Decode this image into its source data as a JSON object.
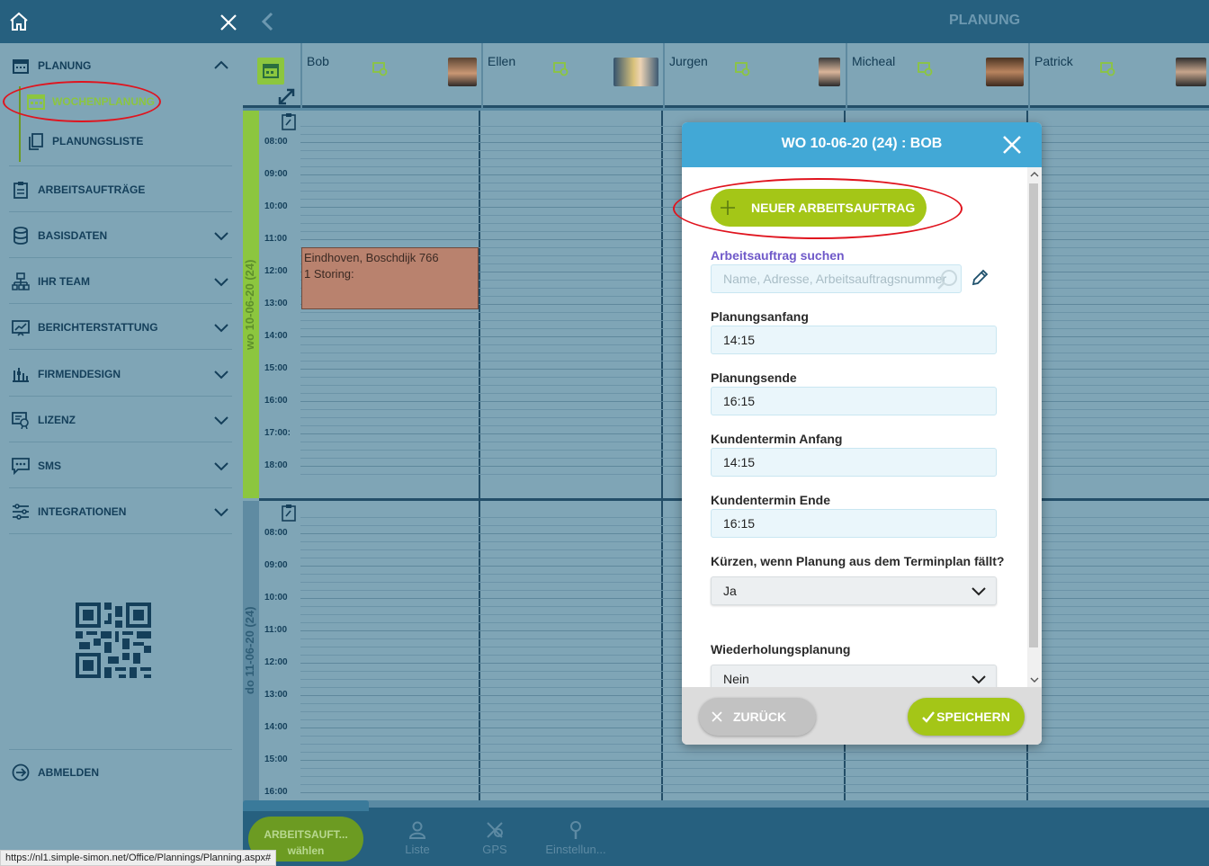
{
  "sidebar": {
    "home_icon": "home-icon",
    "close_icon": "close-icon",
    "planung": {
      "label": "PLANUNG",
      "icon": "calendar-icon"
    },
    "sub_items": [
      {
        "label": "WOCHENPLANUNG",
        "icon": "calendar-icon",
        "active": true
      },
      {
        "label": "PLANUNGSLISTE",
        "icon": "copy-icon",
        "active": false
      }
    ],
    "items": [
      {
        "label": "ARBEITSAUFTRÄGE",
        "icon": "clipboard-icon"
      },
      {
        "label": "BASISDATEN",
        "icon": "database-icon"
      },
      {
        "label": "IHR TEAM",
        "icon": "team-icon"
      },
      {
        "label": "BERICHTERSTATTUNG",
        "icon": "report-icon"
      },
      {
        "label": "FIRMENDESIGN",
        "icon": "design-icon"
      },
      {
        "label": "LIZENZ",
        "icon": "license-icon"
      },
      {
        "label": "SMS",
        "icon": "sms-icon"
      },
      {
        "label": "INTEGRATIONEN",
        "icon": "sliders-icon"
      }
    ],
    "logout_label": "ABMELDEN"
  },
  "header": {
    "title": "PLANUNG",
    "back_icon": "chevron-left-icon"
  },
  "people": [
    "Bob",
    "Ellen",
    "Jurgen",
    "Micheal",
    "Patrick"
  ],
  "days": [
    {
      "label": "wo 10-06-20 (24)",
      "times": [
        "08:00",
        "09:00",
        "10:00",
        "11:00",
        "12:00",
        "13:00",
        "14:00",
        "15:00",
        "16:00",
        "17:00:",
        "18:00"
      ]
    },
    {
      "label": "do 11-06-20 (24)",
      "times": [
        "08:00",
        "09:00",
        "10:00",
        "11:00",
        "12:00",
        "13:00",
        "14:00",
        "15:00",
        "16:00"
      ]
    }
  ],
  "appointment": {
    "line1": "Eindhoven, Boschdijk 766",
    "line2": "1 Storing:"
  },
  "modal": {
    "title": "WO 10-06-20 (24) : BOB",
    "new_order_label": "NEUER ARBEITSAUFTRAG",
    "search_label": "Arbeitsauftrag suchen",
    "search_placeholder": "Name, Adresse, Arbeitsauftragsnummer",
    "fields": [
      {
        "label": "Planungsanfang",
        "value": "14:15"
      },
      {
        "label": "Planungsende",
        "value": "16:15"
      },
      {
        "label": "Kundentermin Anfang",
        "value": "14:15"
      },
      {
        "label": "Kundentermin Ende",
        "value": "16:15"
      }
    ],
    "shorten_label": "Kürzen, wenn Planung aus dem Terminplan fällt?",
    "shorten_value": "Ja",
    "repeat_label": "Wiederholungsplanung",
    "repeat_value": "Nein",
    "back_label": "ZURÜCK",
    "save_label": "SPEICHERN"
  },
  "bottom": {
    "select_line1": "ARBEITSAUFT...",
    "select_line2": "wählen",
    "tabs": [
      {
        "label": "Liste",
        "icon": "person-icon"
      },
      {
        "label": "GPS",
        "icon": "gps-icon"
      },
      {
        "label": "Einstellun...",
        "icon": "settings-icon"
      }
    ]
  },
  "status_url": "https://nl1.simple-simon.net/Office/Plannings/Planning.aspx#",
  "colors": {
    "header": "#26607f",
    "sidebar": "#7fa5b6",
    "accent_green": "#a4c617",
    "modal_header": "#42a8d6",
    "highlight_ring": "#e0141e"
  }
}
